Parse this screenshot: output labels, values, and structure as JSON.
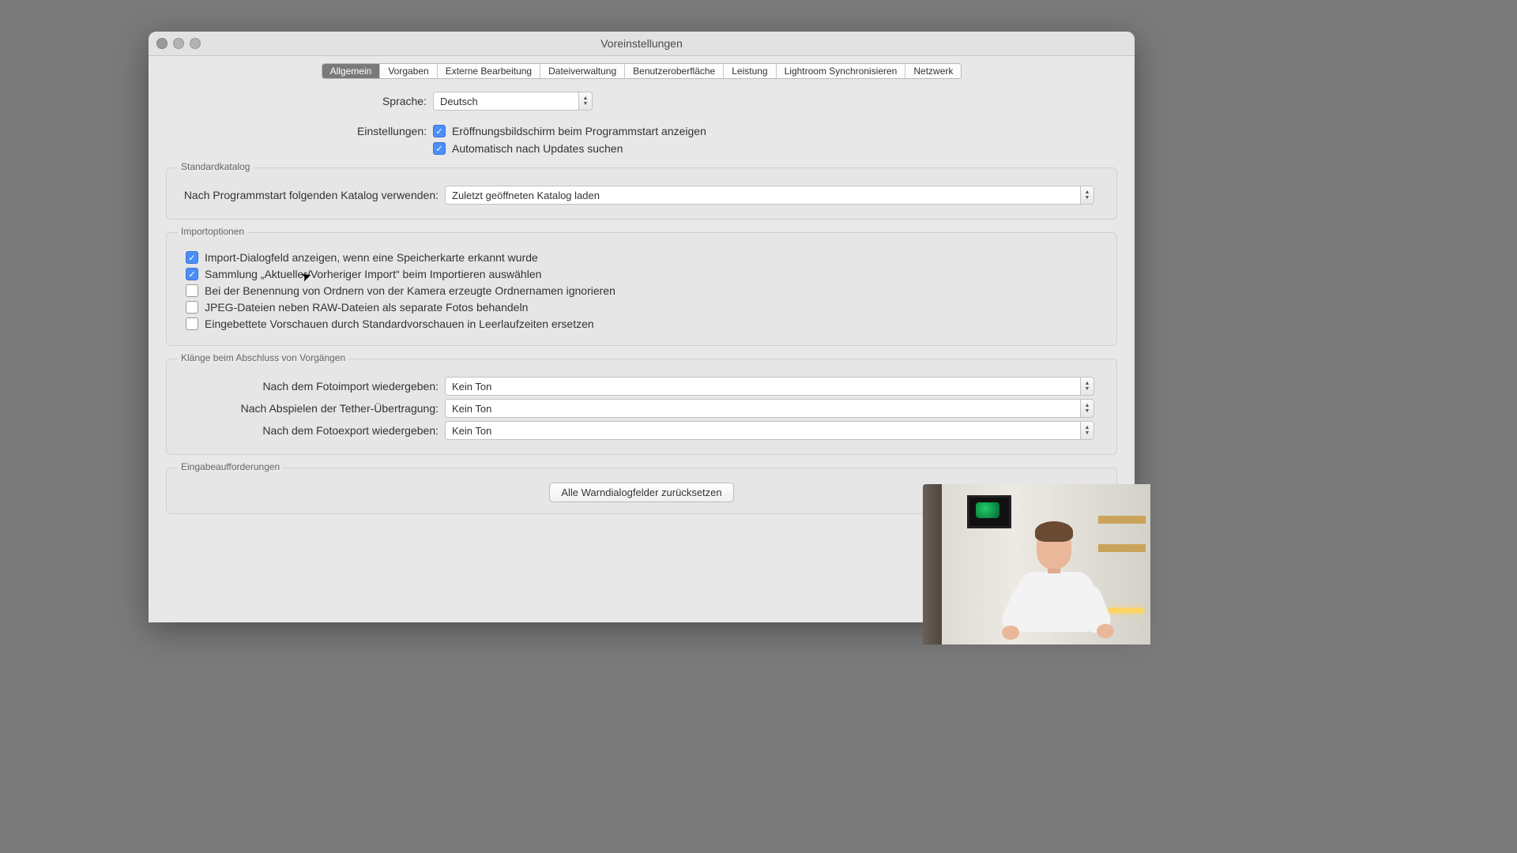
{
  "window": {
    "title": "Voreinstellungen"
  },
  "tabs": [
    {
      "label": "Allgemein",
      "active": true
    },
    {
      "label": "Vorgaben"
    },
    {
      "label": "Externe Bearbeitung"
    },
    {
      "label": "Dateiverwaltung"
    },
    {
      "label": "Benutzeroberfläche"
    },
    {
      "label": "Leistung"
    },
    {
      "label": "Lightroom Synchronisieren"
    },
    {
      "label": "Netzwerk"
    }
  ],
  "language": {
    "label": "Sprache:",
    "value": "Deutsch"
  },
  "settings": {
    "label": "Einstellungen:",
    "opt1": {
      "checked": true,
      "text": "Eröffnungsbildschirm beim Programmstart anzeigen"
    },
    "opt2": {
      "checked": true,
      "text": "Automatisch nach Updates suchen"
    }
  },
  "catalog": {
    "legend": "Standardkatalog",
    "label": "Nach Programmstart folgenden Katalog verwenden:",
    "value": "Zuletzt geöffneten Katalog laden"
  },
  "import": {
    "legend": "Importoptionen",
    "opts": [
      {
        "checked": true,
        "text": "Import-Dialogfeld anzeigen, wenn eine Speicherkarte erkannt wurde"
      },
      {
        "checked": true,
        "text": "Sammlung „Aktueller/Vorheriger Import“ beim Importieren auswählen"
      },
      {
        "checked": false,
        "text": "Bei der Benennung von Ordnern von der Kamera erzeugte Ordnernamen ignorieren"
      },
      {
        "checked": false,
        "text": "JPEG-Dateien neben RAW-Dateien als separate Fotos behandeln"
      },
      {
        "checked": false,
        "text": "Eingebettete Vorschauen durch Standardvorschauen in Leerlaufzeiten ersetzen"
      }
    ]
  },
  "sounds": {
    "legend": "Klänge beim Abschluss von Vorgängen",
    "rows": [
      {
        "label": "Nach dem Fotoimport wiedergeben:",
        "value": "Kein Ton"
      },
      {
        "label": "Nach Abspielen der Tether-Übertragung:",
        "value": "Kein Ton"
      },
      {
        "label": "Nach dem Fotoexport wiedergeben:",
        "value": "Kein Ton"
      }
    ]
  },
  "prompts": {
    "legend": "Eingabeaufforderungen",
    "button": "Alle Warndialogfelder zurücksetzen"
  }
}
